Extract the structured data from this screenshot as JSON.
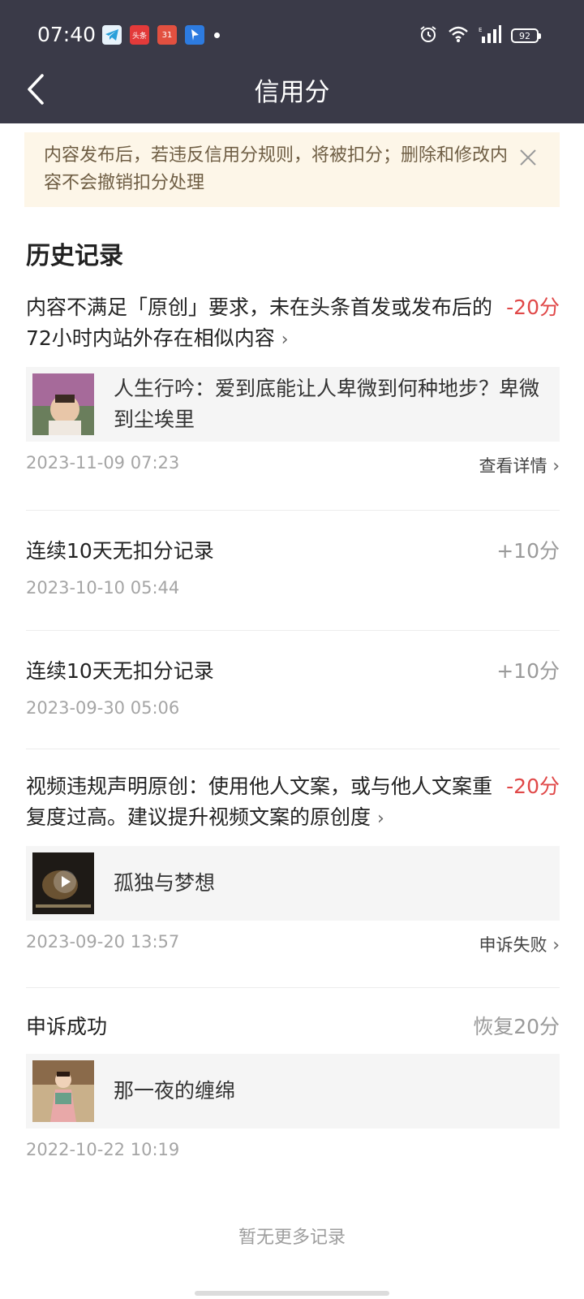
{
  "status_bar": {
    "time": "07:40",
    "toutiao_label": "头条",
    "calendar_label": "31",
    "battery": "92"
  },
  "header": {
    "title": "信用分"
  },
  "notice": {
    "text": "内容发布后，若违反信用分规则，将被扣分；删除和修改内容不会撤销扣分处理"
  },
  "history": {
    "title": "历史记录",
    "records": [
      {
        "title": "内容不满足「原创」要求，未在头条首发或发布后的72小时内站外存在相似内容",
        "score": "-20分",
        "card_text": "人生行吟：爱到底能让人卑微到何种地步？卑微到尘埃里",
        "date": "2023-11-09 07:23",
        "link": "查看详情"
      },
      {
        "title": "连续10天无扣分记录",
        "score": "+10分",
        "date": "2023-10-10 05:44"
      },
      {
        "title": "连续10天无扣分记录",
        "score": "+10分",
        "date": "2023-09-30 05:06"
      },
      {
        "title": "视频违规声明原创：使用他人文案，或与他人文案重复度过高。建议提升视频文案的原创度",
        "score": "-20分",
        "card_text": "孤独与梦想",
        "date": "2023-09-20 13:57",
        "link": "申诉失败"
      },
      {
        "title": "申诉成功",
        "score": "恢复20分",
        "card_text": "那一夜的缠绵",
        "date": "2022-10-22 10:19"
      }
    ]
  },
  "footer": {
    "text": "暂无更多记录"
  },
  "colors": {
    "header_bg": "#3a3a48",
    "negative": "#e04848",
    "neutral": "#9a9a9a",
    "notice_bg": "#fdf6e8"
  }
}
